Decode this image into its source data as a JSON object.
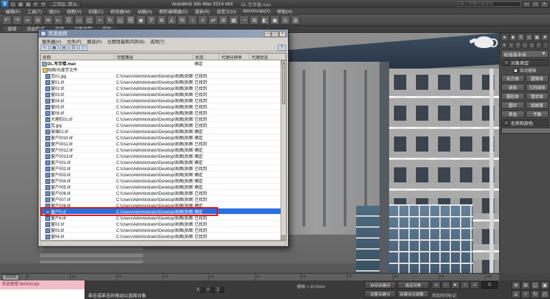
{
  "colors": {
    "selection_blue": "#2a6fe0",
    "annotation_red": "#e51313",
    "roof_navy": "#2c3a4a"
  },
  "titlebar": {
    "logo_glyph": "3",
    "title": "Autodesk 3ds Max 2014 x64",
    "filename": "DL.写字楼.max",
    "workspace": "工作区: 默认",
    "search_placeholder": "输入关键字或短语",
    "quick_access": [
      {
        "name": "new-file-icon",
        "glyph": "▢"
      },
      {
        "name": "open-file-icon",
        "glyph": "▤"
      },
      {
        "name": "save-file-icon",
        "glyph": "▥"
      },
      {
        "name": "undo-icon",
        "glyph": "↶"
      },
      {
        "name": "redo-icon",
        "glyph": "↷"
      }
    ],
    "window_buttons": [
      {
        "name": "minimize-button",
        "glyph": "—"
      },
      {
        "name": "maximize-button",
        "glyph": "□"
      },
      {
        "name": "close-button",
        "glyph": "×"
      }
    ]
  },
  "menubar": {
    "items": [
      "编辑(E)",
      "工具(T)",
      "组(G)",
      "视图(V)",
      "创建(C)",
      "修改器(M)",
      "动画(A)",
      "图形编辑器(D)",
      "渲染(R)",
      "自定义(U)",
      "MAXScript(X)",
      "帮助(H)"
    ]
  },
  "main_toolbar": {
    "icons": [
      {
        "name": "undo-icon",
        "glyph": "↶"
      },
      {
        "name": "redo-icon",
        "glyph": "↷"
      },
      {
        "name": "select-link-icon",
        "glyph": "∞"
      },
      {
        "name": "unlink-icon",
        "glyph": "⊘"
      },
      {
        "name": "bind-spacewarp-icon",
        "glyph": "≋"
      },
      {
        "name": "select-object-icon",
        "glyph": "▻"
      },
      {
        "name": "select-by-name-icon",
        "glyph": "☰"
      },
      {
        "name": "selection-region-icon",
        "glyph": "▭"
      },
      {
        "name": "window-crossing-icon",
        "glyph": "◫"
      },
      {
        "name": "select-move-icon",
        "glyph": "+"
      },
      {
        "name": "select-rotate-icon",
        "glyph": "↻"
      },
      {
        "name": "select-scale-icon",
        "glyph": "◱"
      },
      {
        "name": "reference-coordinate-icon",
        "glyph": "视"
      },
      {
        "name": "pivot-center-icon",
        "glyph": "◉"
      },
      {
        "name": "select-manipulate-icon",
        "glyph": "∇"
      },
      {
        "name": "snap-toggle-icon",
        "glyph": "⊕"
      },
      {
        "name": "angle-snap-icon",
        "glyph": "∠"
      },
      {
        "name": "percent-snap-icon",
        "glyph": "%"
      },
      {
        "name": "spinner-snap-icon",
        "glyph": "↕"
      },
      {
        "name": "named-selection-icon",
        "glyph": "≡"
      },
      {
        "name": "mirror-icon",
        "glyph": "⇄"
      },
      {
        "name": "align-icon",
        "glyph": "≣"
      },
      {
        "name": "layer-manager-icon",
        "glyph": "▦"
      },
      {
        "name": "curve-editor-icon",
        "glyph": "◔"
      },
      {
        "name": "schematic-view-icon",
        "glyph": "⊞"
      },
      {
        "name": "material-editor-icon",
        "glyph": "◧"
      },
      {
        "name": "render-setup-icon",
        "glyph": "▣"
      },
      {
        "name": "render-frame-icon",
        "glyph": "◘"
      },
      {
        "name": "render-production-icon",
        "glyph": "◍"
      }
    ]
  },
  "ribbon": {
    "tabs": [
      "建模",
      "自由形式",
      "选择",
      "对象绘制",
      "填充"
    ]
  },
  "dialog": {
    "title": "资源追踪",
    "help_glyph": "?",
    "menus": [
      "服务器(V)",
      "文件(F)",
      "路径(P)",
      "位图性能和内存(B)",
      "选项(T)"
    ],
    "toolbar_icons": [
      {
        "name": "refresh-icon",
        "glyph": "↻"
      },
      {
        "name": "highlight-editable-icon",
        "glyph": "▣"
      },
      {
        "name": "browse-icon",
        "glyph": "▤"
      },
      {
        "name": "details-icon",
        "glyph": "☰"
      },
      {
        "name": "filter-icon",
        "glyph": "▽"
      }
    ],
    "columns": [
      "名称",
      "完整路径",
      "状态",
      "代理分辨率",
      "代理状态"
    ],
    "rows": [
      {
        "cls": "root",
        "name": "DL.写字楼.max",
        "path": "",
        "status": "确定"
      },
      {
        "cls": "group",
        "name": "贴图/光度学文件",
        "path": "",
        "status": ""
      },
      {
        "cls": "file",
        "name": "瓦01.jpg",
        "path": "C:\\Users\\Administrator\\Desktop\\贴图(贴图贴图).DL",
        "status": "已找到"
      },
      {
        "cls": "file",
        "name": "窗01.tif",
        "path": "C:\\Users\\Administrator\\Desktop\\贴图(贴图贴图).DL",
        "status": "已找到"
      },
      {
        "cls": "file",
        "name": "窗02.tif",
        "path": "C:\\Users\\Administrator\\Desktop\\贴图(贴图贴图).DL",
        "status": "已找到"
      },
      {
        "cls": "file",
        "name": "窗03.tif",
        "path": "C:\\Users\\Administrator\\Desktop\\贴图(贴图贴图).DL",
        "status": "已找到"
      },
      {
        "cls": "file",
        "name": "窗04.tif",
        "path": "C:\\Users\\Administrator\\Desktop\\贴图(贴图贴图).DL",
        "status": "已找到"
      },
      {
        "cls": "file",
        "name": "窗05.tif",
        "path": "C:\\Users\\Administrator\\Desktop\\贴图(贴图贴图).DL",
        "status": "已找到"
      },
      {
        "cls": "file",
        "name": "窗06.tif",
        "path": "C:\\Users\\Administrator\\Desktop\\贴图(贴图贴图).DL",
        "status": "已找到"
      },
      {
        "cls": "file",
        "name": "大理石01.tif",
        "path": "C:\\Users\\Administrator\\Desktop\\贴图(贴图贴图).DL",
        "status": "已找到"
      },
      {
        "cls": "file",
        "name": "瓦.jpg",
        "path": "C:\\Users\\Administrator\\Desktop\\贴图(贴图贴图).DL",
        "status": "已找到"
      },
      {
        "cls": "file",
        "name": "玻璃01.tif",
        "path": "C:\\Users\\Administrator\\Desktop\\贴图(贴图贴图).DL",
        "status": "确定"
      },
      {
        "cls": "file",
        "name": "窗户0010.tif",
        "path": "C:\\Users\\Administrator\\Desktop\\贴图(贴图贴图).DL",
        "status": "确定"
      },
      {
        "cls": "file",
        "name": "窗户0011.tif",
        "path": "C:\\Users\\Administrator\\Desktop\\贴图(贴图贴图).DL",
        "status": "已找到"
      },
      {
        "cls": "file",
        "name": "窗户0012.tif",
        "path": "C:\\Users\\Administrator\\Desktop\\贴图(贴图贴图).DL",
        "status": "确定"
      },
      {
        "cls": "file",
        "name": "窗户0013.tif",
        "path": "C:\\Users\\Administrator\\Desktop\\贴图(贴图贴图).DL",
        "status": "确定"
      },
      {
        "cls": "file",
        "name": "窗户001.tif",
        "path": "C:\\Users\\Administrator\\Desktop\\贴图(贴图贴图).DL",
        "status": "确定"
      },
      {
        "cls": "file",
        "name": "窗户002.tif",
        "path": "C:\\Users\\Administrator\\Desktop\\贴图(贴图贴图).DL",
        "status": "已找到"
      },
      {
        "cls": "file",
        "name": "窗户003.tif",
        "path": "C:\\Users\\Administrator\\Desktop\\贴图(贴图贴图).DL",
        "status": "确定"
      },
      {
        "cls": "file",
        "name": "窗户004.tif",
        "path": "C:\\Users\\Administrator\\Desktop\\贴图(贴图贴图).DL",
        "status": "确定"
      },
      {
        "cls": "file",
        "name": "窗户005.tif",
        "path": "C:\\Users\\Administrator\\Desktop\\贴图(贴图贴图).DL",
        "status": "确定"
      },
      {
        "cls": "file",
        "name": "窗户006.tif",
        "path": "C:\\Users\\Administrator\\Desktop\\贴图(贴图贴图).DL",
        "status": "已找到"
      },
      {
        "cls": "file",
        "name": "窗户007.tif",
        "path": "C:\\Users\\Administrator\\Desktop\\贴图(贴图贴图).DL",
        "status": "已找到"
      },
      {
        "cls": "file",
        "name": "窗户008.tif",
        "path": "C:\\Users\\Administrator\\Desktop\\贴图(贴图贴图).DL",
        "status": "确定"
      },
      {
        "cls": "file",
        "name": "窗户5.tif",
        "path": "C:\\Users\\Administrator\\Desktop\\贴图(贴图贴图).DL",
        "status": "确定",
        "selected": true
      },
      {
        "cls": "file",
        "name": "窗户6.tif",
        "path": "C:\\Users\\Administrator\\Desktop\\贴图(贴图贴图).DL",
        "status": "已找到"
      },
      {
        "cls": "file",
        "name": "窗02.tif",
        "path": "C:\\Users\\Administrator\\Desktop\\贴图(贴图贴图).DL",
        "status": "已找到"
      },
      {
        "cls": "file",
        "name": "窗03.tif",
        "path": "C:\\Users\\Administrator\\Desktop\\贴图(贴图贴图).DL",
        "status": "已找到"
      },
      {
        "cls": "file",
        "name": "窗04.tif",
        "path": "C:\\Users\\Administrator\\Desktop\\贴图(贴图贴图).DL",
        "status": "已找到"
      }
    ]
  },
  "command_panel": {
    "tabs": [
      {
        "name": "create-tab-icon",
        "glyph": "►"
      },
      {
        "name": "modify-tab-icon",
        "glyph": "◉"
      },
      {
        "name": "hierarchy-tab-icon",
        "glyph": "☰"
      },
      {
        "name": "motion-tab-icon",
        "glyph": "◎"
      },
      {
        "name": "display-tab-icon",
        "glyph": "▦"
      },
      {
        "name": "utilities-tab-icon",
        "glyph": "✚"
      }
    ],
    "categories": [
      {
        "name": "geometry-icon",
        "glyph": "●"
      },
      {
        "name": "shapes-icon",
        "glyph": "◇"
      },
      {
        "name": "lights-icon",
        "glyph": "▽"
      },
      {
        "name": "cameras-icon",
        "glyph": "□"
      },
      {
        "name": "helpers-icon",
        "glyph": "△"
      },
      {
        "name": "spacewarps-icon",
        "glyph": "☆"
      },
      {
        "name": "systems-icon",
        "glyph": "◦"
      }
    ],
    "dropdown": "标准基本体",
    "dropdown_arrow": "▼",
    "object_type": "对象类型",
    "autogrid": "自动栅格",
    "buttons": [
      "长方体",
      "圆锥体",
      "球体",
      "几何球体",
      "圆柱体",
      "管状体",
      "圆环",
      "四棱锥",
      "茶壶",
      "平面"
    ],
    "name_color": "名称和颜色",
    "collapse_glyph": "−"
  },
  "timeline": {
    "slider": "0/100",
    "ticks": [
      "0",
      "10",
      "20",
      "30",
      "40",
      "50",
      "60",
      "70",
      "80",
      "90",
      "100"
    ]
  },
  "statusbar": {
    "listener_line": "欢迎使用 MAXScript",
    "status_text": "单击或单击并拖动以选择对象",
    "coords": [
      {
        "label": "X:",
        "value": ""
      },
      {
        "label": "Y:",
        "value": ""
      },
      {
        "label": "Z:",
        "value": ""
      }
    ],
    "grid_label": "栅格 = 10.0mm",
    "auto_key": "自动关键点",
    "set_key": "设置关键点",
    "selection_set": "选定对象",
    "key_filters": "关键点过滤器...",
    "frame": "0",
    "time_tag": "添加时间标记",
    "playback": [
      {
        "name": "go-to-start-icon",
        "glyph": "«"
      },
      {
        "name": "previous-frame-icon",
        "glyph": "‹"
      },
      {
        "name": "play-icon",
        "glyph": "►"
      },
      {
        "name": "next-frame-icon",
        "glyph": "›"
      },
      {
        "name": "go-to-end-icon",
        "glyph": "»"
      }
    ],
    "nav": [
      {
        "name": "zoom-icon",
        "glyph": "⊕"
      },
      {
        "name": "zoom-all-icon",
        "glyph": "⊞"
      },
      {
        "name": "zoom-extents-icon",
        "glyph": "◱"
      },
      {
        "name": "zoom-extents-all-icon",
        "glyph": "▣"
      },
      {
        "name": "field-of-view-icon",
        "glyph": "∠"
      },
      {
        "name": "pan-icon",
        "glyph": "+"
      },
      {
        "name": "orbit-icon",
        "glyph": "↻"
      },
      {
        "name": "maximize-viewport-icon",
        "glyph": "◰"
      }
    ]
  }
}
